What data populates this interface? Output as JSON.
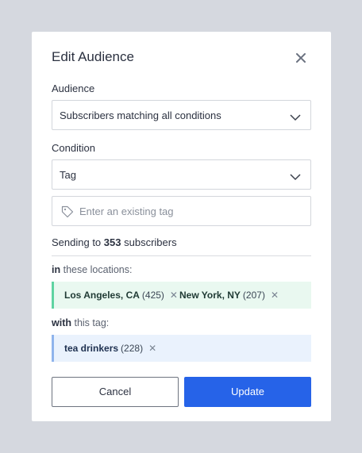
{
  "modal": {
    "title": "Edit Audience",
    "close_icon": "close-icon"
  },
  "audience": {
    "label": "Audience",
    "selected": "Subscribers matching all conditions"
  },
  "condition": {
    "label": "Condition",
    "selected": "Tag",
    "tag_input_placeholder": "Enter an existing tag",
    "tag_input_value": ""
  },
  "summary": {
    "prefix": "Sending to",
    "count": "353",
    "suffix": "subscribers"
  },
  "locations": {
    "label_bold": "in",
    "label_rest": "these locations:",
    "items": [
      {
        "name": "Los Angeles, CA",
        "count": "(425)"
      },
      {
        "name": "New York, NY",
        "count": "(207)"
      }
    ]
  },
  "tags": {
    "label_bold": "with",
    "label_rest": "this tag:",
    "items": [
      {
        "name": "tea drinkers",
        "count": "(228)"
      }
    ]
  },
  "actions": {
    "cancel_label": "Cancel",
    "update_label": "Update"
  },
  "colors": {
    "primary": "#2663e8",
    "location_accent": "#5fd3a2",
    "location_bg": "#e9f8f0",
    "tag_accent": "#8fb4ec",
    "tag_bg": "#eaf2fd"
  }
}
